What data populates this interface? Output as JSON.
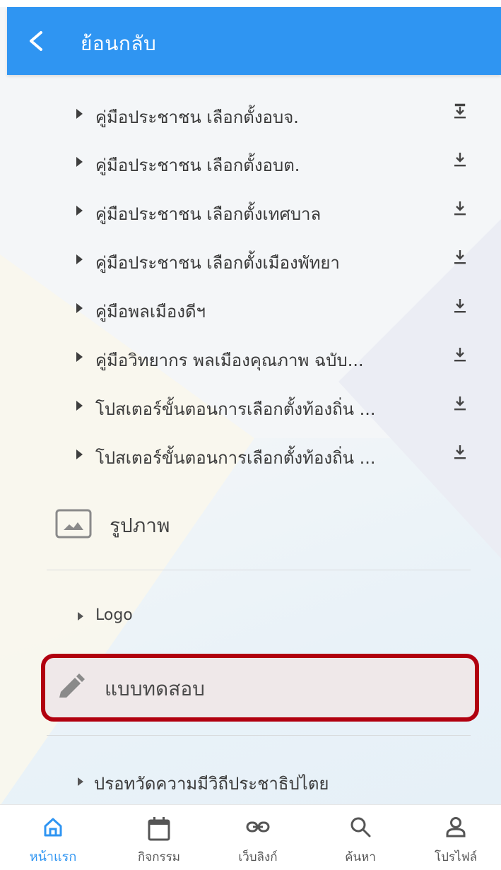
{
  "header": {
    "back_label": "ย้อนกลับ"
  },
  "documents": [
    {
      "label": "คู่มือประชาชน เลือกตั้งอบจ."
    },
    {
      "label": "คู่มือประชาชน เลือกตั้งอบต."
    },
    {
      "label": "คู่มือประชาชน เลือกตั้งเทศบาล"
    },
    {
      "label": "คู่มือประชาชน เลือกตั้งเมืองพัทยา"
    },
    {
      "label": "คู่มือพลเมืองดีฯ"
    },
    {
      "label": "คู่มือวิทยากร พลเมืองคุณภาพ ฉบับ..."
    },
    {
      "label": "โปสเตอร์ขั้นตอนการเลือกตั้งท้องถิ่น ..."
    },
    {
      "label": "โปสเตอร์ขั้นตอนการเลือกตั้งท้องถิ่น ..."
    }
  ],
  "images_section": {
    "title": "รูปภาพ",
    "items": [
      {
        "label": "Logo"
      }
    ]
  },
  "quiz_section": {
    "title": "แบบทดสอบ",
    "items": [
      {
        "label": "ปรอทวัดความมีวิถีประชาธิปไตย"
      }
    ]
  },
  "bottom_nav": {
    "active": "home",
    "items": [
      {
        "id": "home",
        "label": "หน้าแรก",
        "icon": "home-icon"
      },
      {
        "id": "activities",
        "label": "กิจกรรม",
        "icon": "calendar-icon"
      },
      {
        "id": "weblinks",
        "label": "เว็บลิงก์",
        "icon": "link-icon"
      },
      {
        "id": "search",
        "label": "ค้นหา",
        "icon": "search-icon"
      },
      {
        "id": "profile",
        "label": "โปรไฟล์",
        "icon": "profile-icon"
      }
    ]
  },
  "colors": {
    "primary": "#2f95f2",
    "highlight_border": "#b1000f"
  }
}
